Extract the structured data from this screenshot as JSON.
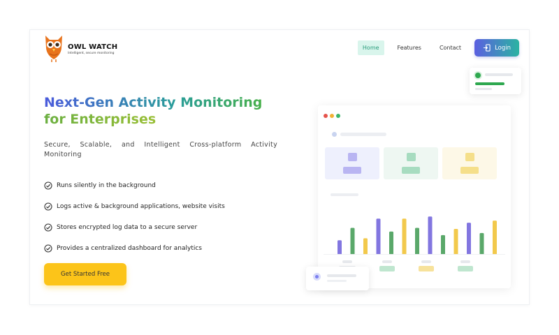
{
  "brand": {
    "name": "OWL WATCH",
    "tagline": "Intelligent, secure monitoring",
    "logo_color": "#e8731c"
  },
  "nav": {
    "items": [
      {
        "label": "Home",
        "active": true
      },
      {
        "label": "Features",
        "active": false
      },
      {
        "label": "Contact",
        "active": false
      }
    ],
    "login_label": "Login"
  },
  "hero": {
    "title_line1": "Next-Gen Activity Monitoring",
    "title_line2": "for Enterprises",
    "subtitle": "Secure, Scalable, and Intelligent Cross-platform Activity Monitoring",
    "features": [
      "Runs silently in the background",
      "Logs active & background applications, website visits",
      "Stores encrypted log data to a secure server",
      "Provides a centralized dashboard for analytics"
    ],
    "cta_label": "Get Started Free"
  },
  "illustration": {
    "window_dots": [
      "#e5534b",
      "#f2b134",
      "#3cb56a"
    ],
    "cards": [
      {
        "bg": "#eef0fd",
        "accent": "#b9b5f2",
        "accent2": "#b9b5f2"
      },
      {
        "bg": "#eef7f2",
        "accent": "#a7dcc0",
        "accent2": "#a7dcc0"
      },
      {
        "bg": "#fdf8e7",
        "accent": "#f5df8a",
        "accent2": "#f5df8a"
      }
    ],
    "chart_bar_heights": [
      0.28,
      0.52,
      0.32,
      0.7,
      0.45,
      0.7,
      0.52,
      0.74,
      0.38,
      0.5,
      0.62,
      0.42,
      0.66
    ],
    "chart_bar_colors": [
      "#8276e0",
      "#5aa86a",
      "#f2c94c",
      "#8276e0",
      "#5aa86a",
      "#f2c94c",
      "#5aa86a",
      "#8276e0",
      "#5aa86a",
      "#f2c94c",
      "#8276e0",
      "#5aa86a",
      "#f2c94c"
    ],
    "legend_colors": [
      "#ffffff",
      "#bfe6cf",
      "#f7e29b",
      "#bfe6cf"
    ]
  }
}
